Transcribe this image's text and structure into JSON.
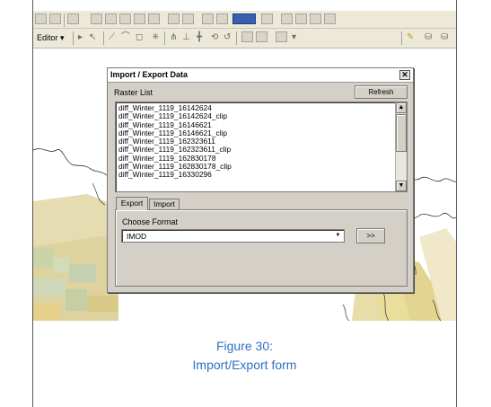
{
  "toolbar": {
    "editor_label": "Editor ▾"
  },
  "dialog": {
    "title": "Import / Export Data",
    "close_label": "✕",
    "raster_list_label": "Raster List",
    "refresh_label": "Refresh",
    "raster_items": [
      "diff_Winter_1119_16142624",
      "diff_Winter_1119_16142624_clip",
      "diff_Winter_1119_16146621",
      "diff_Winter_1119_16146621_clip",
      "diff_Winter_1119_162323611",
      "diff_Winter_1119_162323611_clip",
      "diff_Winter_1119_162830178",
      "diff_Winter_1119_162830178_clip",
      "diff_Winter_1119_16330296"
    ],
    "tabs": {
      "export_label": "Export",
      "import_label": "Import",
      "selected": "Export"
    },
    "choose_format_label": "Choose Format",
    "format_value": "IMOD",
    "go_label": ">>"
  },
  "caption": {
    "line1": "Figure 30:",
    "line2": "Import/Export form"
  },
  "colors": {
    "caption": "#3070c0",
    "dialog_face": "#d4d0c8",
    "toolbar": "#ece9d8"
  }
}
